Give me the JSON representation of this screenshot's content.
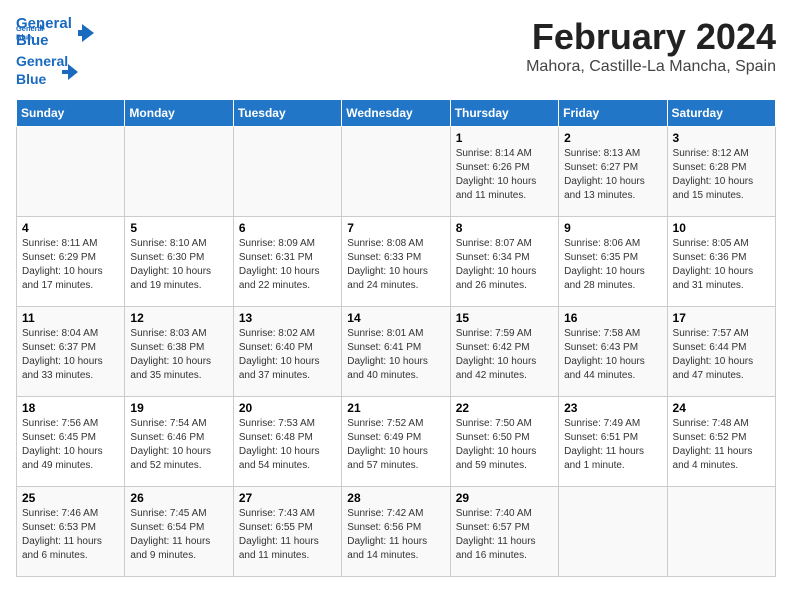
{
  "header": {
    "title": "February 2024",
    "location": "Mahora, Castille-La Mancha, Spain",
    "logo_line1": "General",
    "logo_line2": "Blue"
  },
  "days_of_week": [
    "Sunday",
    "Monday",
    "Tuesday",
    "Wednesday",
    "Thursday",
    "Friday",
    "Saturday"
  ],
  "weeks": [
    [
      {
        "day": "",
        "info": ""
      },
      {
        "day": "",
        "info": ""
      },
      {
        "day": "",
        "info": ""
      },
      {
        "day": "",
        "info": ""
      },
      {
        "day": "1",
        "info": "Sunrise: 8:14 AM\nSunset: 6:26 PM\nDaylight: 10 hours\nand 11 minutes."
      },
      {
        "day": "2",
        "info": "Sunrise: 8:13 AM\nSunset: 6:27 PM\nDaylight: 10 hours\nand 13 minutes."
      },
      {
        "day": "3",
        "info": "Sunrise: 8:12 AM\nSunset: 6:28 PM\nDaylight: 10 hours\nand 15 minutes."
      }
    ],
    [
      {
        "day": "4",
        "info": "Sunrise: 8:11 AM\nSunset: 6:29 PM\nDaylight: 10 hours\nand 17 minutes."
      },
      {
        "day": "5",
        "info": "Sunrise: 8:10 AM\nSunset: 6:30 PM\nDaylight: 10 hours\nand 19 minutes."
      },
      {
        "day": "6",
        "info": "Sunrise: 8:09 AM\nSunset: 6:31 PM\nDaylight: 10 hours\nand 22 minutes."
      },
      {
        "day": "7",
        "info": "Sunrise: 8:08 AM\nSunset: 6:33 PM\nDaylight: 10 hours\nand 24 minutes."
      },
      {
        "day": "8",
        "info": "Sunrise: 8:07 AM\nSunset: 6:34 PM\nDaylight: 10 hours\nand 26 minutes."
      },
      {
        "day": "9",
        "info": "Sunrise: 8:06 AM\nSunset: 6:35 PM\nDaylight: 10 hours\nand 28 minutes."
      },
      {
        "day": "10",
        "info": "Sunrise: 8:05 AM\nSunset: 6:36 PM\nDaylight: 10 hours\nand 31 minutes."
      }
    ],
    [
      {
        "day": "11",
        "info": "Sunrise: 8:04 AM\nSunset: 6:37 PM\nDaylight: 10 hours\nand 33 minutes."
      },
      {
        "day": "12",
        "info": "Sunrise: 8:03 AM\nSunset: 6:38 PM\nDaylight: 10 hours\nand 35 minutes."
      },
      {
        "day": "13",
        "info": "Sunrise: 8:02 AM\nSunset: 6:40 PM\nDaylight: 10 hours\nand 37 minutes."
      },
      {
        "day": "14",
        "info": "Sunrise: 8:01 AM\nSunset: 6:41 PM\nDaylight: 10 hours\nand 40 minutes."
      },
      {
        "day": "15",
        "info": "Sunrise: 7:59 AM\nSunset: 6:42 PM\nDaylight: 10 hours\nand 42 minutes."
      },
      {
        "day": "16",
        "info": "Sunrise: 7:58 AM\nSunset: 6:43 PM\nDaylight: 10 hours\nand 44 minutes."
      },
      {
        "day": "17",
        "info": "Sunrise: 7:57 AM\nSunset: 6:44 PM\nDaylight: 10 hours\nand 47 minutes."
      }
    ],
    [
      {
        "day": "18",
        "info": "Sunrise: 7:56 AM\nSunset: 6:45 PM\nDaylight: 10 hours\nand 49 minutes."
      },
      {
        "day": "19",
        "info": "Sunrise: 7:54 AM\nSunset: 6:46 PM\nDaylight: 10 hours\nand 52 minutes."
      },
      {
        "day": "20",
        "info": "Sunrise: 7:53 AM\nSunset: 6:48 PM\nDaylight: 10 hours\nand 54 minutes."
      },
      {
        "day": "21",
        "info": "Sunrise: 7:52 AM\nSunset: 6:49 PM\nDaylight: 10 hours\nand 57 minutes."
      },
      {
        "day": "22",
        "info": "Sunrise: 7:50 AM\nSunset: 6:50 PM\nDaylight: 10 hours\nand 59 minutes."
      },
      {
        "day": "23",
        "info": "Sunrise: 7:49 AM\nSunset: 6:51 PM\nDaylight: 11 hours\nand 1 minute."
      },
      {
        "day": "24",
        "info": "Sunrise: 7:48 AM\nSunset: 6:52 PM\nDaylight: 11 hours\nand 4 minutes."
      }
    ],
    [
      {
        "day": "25",
        "info": "Sunrise: 7:46 AM\nSunset: 6:53 PM\nDaylight: 11 hours\nand 6 minutes."
      },
      {
        "day": "26",
        "info": "Sunrise: 7:45 AM\nSunset: 6:54 PM\nDaylight: 11 hours\nand 9 minutes."
      },
      {
        "day": "27",
        "info": "Sunrise: 7:43 AM\nSunset: 6:55 PM\nDaylight: 11 hours\nand 11 minutes."
      },
      {
        "day": "28",
        "info": "Sunrise: 7:42 AM\nSunset: 6:56 PM\nDaylight: 11 hours\nand 14 minutes."
      },
      {
        "day": "29",
        "info": "Sunrise: 7:40 AM\nSunset: 6:57 PM\nDaylight: 11 hours\nand 16 minutes."
      },
      {
        "day": "",
        "info": ""
      },
      {
        "day": "",
        "info": ""
      }
    ]
  ]
}
